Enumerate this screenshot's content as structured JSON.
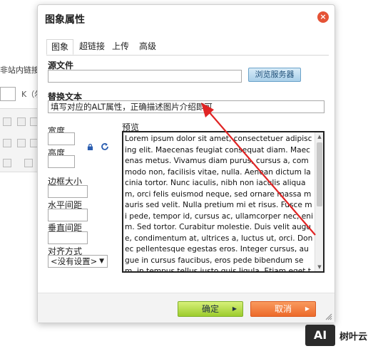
{
  "background": {
    "link_text": "非站内链接",
    "k_label": "K（尔"
  },
  "dialog": {
    "title": "图象属性",
    "close_symbol": "×",
    "tabs": [
      {
        "label": "图象",
        "active": true
      },
      {
        "label": "超链接",
        "active": false
      },
      {
        "label": "上传",
        "active": false
      },
      {
        "label": "高级",
        "active": false
      }
    ],
    "source": {
      "label": "源文件",
      "value": "",
      "browse_label": "浏览服务器"
    },
    "alt": {
      "label": "替换文本",
      "value": "填写对应的ALT属性，正确描述图片介绍即可"
    },
    "width": {
      "label": "宽度",
      "value": ""
    },
    "height": {
      "label": "高度",
      "value": ""
    },
    "border": {
      "label": "边框大小",
      "value": ""
    },
    "hspace": {
      "label": "水平间距",
      "value": ""
    },
    "vspace": {
      "label": "垂直间距",
      "value": ""
    },
    "align": {
      "label": "对齐方式",
      "selected": "<没有设置>"
    },
    "preview": {
      "label": "预览",
      "text": "Lorem ipsum dolor sit amet, consectetuer adipiscing elit. Maecenas feugiat consequat diam. Maecenas metus. Vivamus diam purus, cursus a, commodo non, facilisis vitae, nulla. Aenean dictum lacinia tortor. Nunc iaculis, nibh non iaculis aliquam, orci felis euismod neque, sed ornare massa mauris sed velit. Nulla pretium mi et risus. Fusce mi pede, tempor id, cursus ac, ullamcorper nec, enim. Sed tortor. Curabitur molestie. Duis velit augue, condimentum at, ultrices a, luctus ut, orci. Donec pellentesque egestas eros. Integer cursus, augue in cursus faucibus, eros pede bibendum sem, in tempus tellus justo quis ligula. Etiam eget tortor. Vestibulum rutrum, est ut placerat elementum"
    },
    "ok_label": "确定",
    "cancel_label": "取消"
  },
  "watermark": {
    "logo": "AI",
    "text": "树叶云"
  },
  "colors": {
    "close": "#e55336",
    "ok": "#9ccc2c",
    "cancel": "#ec6a2a",
    "browse": "#a9cfe9",
    "arrow": "#e02424"
  }
}
